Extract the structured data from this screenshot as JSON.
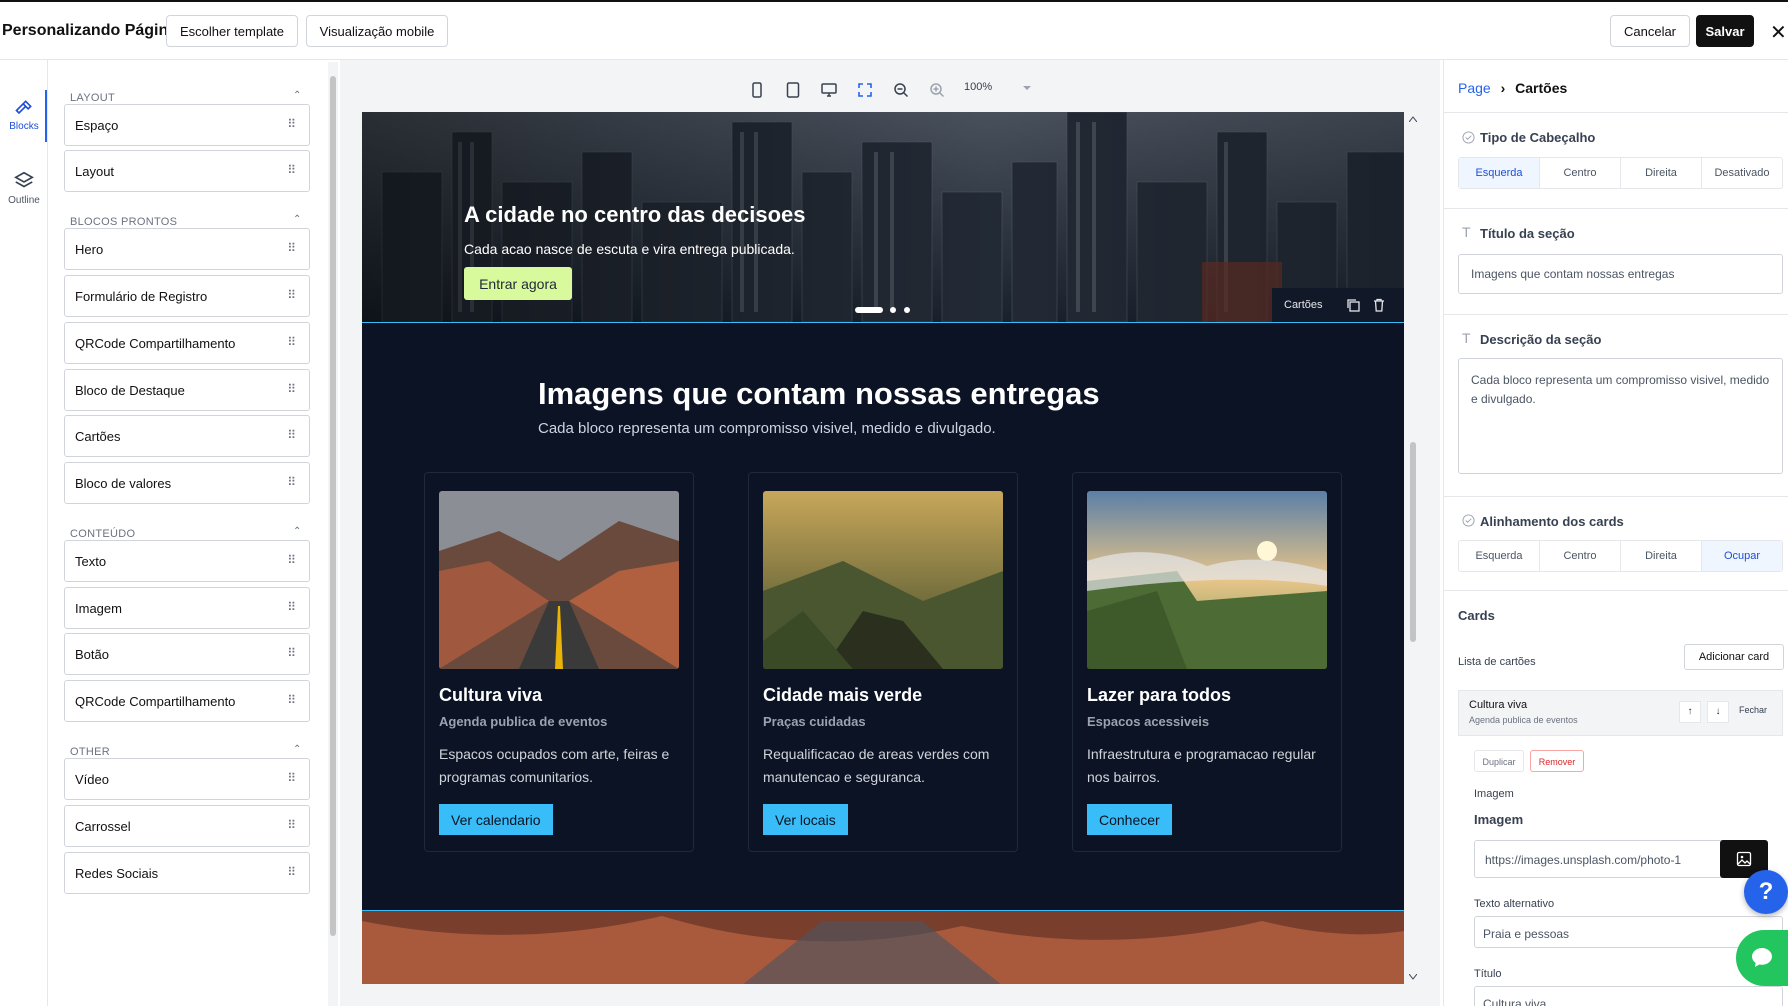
{
  "header": {
    "title": "Personalizando Página",
    "choose_template": "Escolher template",
    "mobile_preview": "Visualização mobile",
    "cancel": "Cancelar",
    "save": "Salvar",
    "close": "✕"
  },
  "rail": [
    {
      "label": "Blocks",
      "active": true
    },
    {
      "label": "Outline",
      "active": false
    }
  ],
  "panel": {
    "sections": [
      {
        "title": "LAYOUT",
        "items": [
          "Espaço",
          "Layout"
        ]
      },
      {
        "title": "BLOCOS PRONTOS",
        "items": [
          "Hero",
          "Formulário de Registro",
          "QRCode Compartilhamento",
          "Bloco de Destaque",
          "Cartões",
          "Bloco de valores"
        ]
      },
      {
        "title": "CONTEÚDO",
        "items": [
          "Texto",
          "Imagem",
          "Botão",
          "QRCode Compartilhamento"
        ]
      },
      {
        "title": "OTHER",
        "items": [
          "Vídeo",
          "Carrossel",
          "Redes Sociais"
        ]
      }
    ]
  },
  "toolbar": {
    "zoom": "100%"
  },
  "preview": {
    "hero": {
      "title": "A cidade no centro das decisoes",
      "subtitle": "Cada acao nasce de escuta e vira entrega publicada.",
      "button": "Entrar agora",
      "badge": "Cartões"
    },
    "section": {
      "title": "Imagens que contam nossas entregas",
      "description": "Cada bloco representa um compromisso visivel, medido e divulgado."
    },
    "cards": [
      {
        "title": "Cultura viva",
        "subtitle": "Agenda publica de eventos",
        "text": "Espacos ocupados com arte, feiras e programas comunitarios.",
        "button": "Ver calendario"
      },
      {
        "title": "Cidade mais verde",
        "subtitle": "Praças cuidadas",
        "text": "Requalificacao de areas verdes com manutencao e seguranca.",
        "button": "Ver locais"
      },
      {
        "title": "Lazer para todos",
        "subtitle": "Espacos acessiveis",
        "text": "Infraestrutura e programacao regular nos bairros.",
        "button": "Conhecer"
      }
    ]
  },
  "inspector": {
    "breadcrumb_root": "Page",
    "breadcrumb_sep": "›",
    "breadcrumb_current": "Cartões",
    "header_type": {
      "label": "Tipo de Cabeçalho",
      "options": [
        "Esquerda",
        "Centro",
        "Direita",
        "Desativado"
      ],
      "selected": "Esquerda"
    },
    "section_title": {
      "label": "Título da seção",
      "value": "Imagens que contam nossas entregas"
    },
    "section_desc": {
      "label": "Descrição da seção",
      "value": "Cada bloco representa um compromisso visivel, medido e divulgado."
    },
    "cards_align": {
      "label": "Alinhamento dos cards",
      "options": [
        "Esquerda",
        "Centro",
        "Direita",
        "Ocupar"
      ],
      "selected": "Ocupar"
    },
    "cards": {
      "label": "Cards",
      "list_label": "Lista de cartões",
      "add": "Adicionar card",
      "item": {
        "title": "Cultura viva",
        "subtitle": "Agenda publica de eventos",
        "close": "Fechar",
        "duplicate": "Duplicar",
        "remove": "Remover"
      },
      "image_section": "Imagem",
      "image_label": "Imagem",
      "image_value": "https://images.unsplash.com/photo-1",
      "alt_label": "Texto alternativo",
      "alt_value": "Praia e pessoas",
      "title_label": "Título",
      "title_value": "Cultura viva"
    }
  },
  "colors": {
    "accent": "#2563eb",
    "dark_section": "#0b1324",
    "card_button": "#38bdf8",
    "hero_button": "#d9f99d",
    "help": "#2563eb",
    "chat": "#22c55e"
  },
  "icons": {
    "help": "?"
  }
}
